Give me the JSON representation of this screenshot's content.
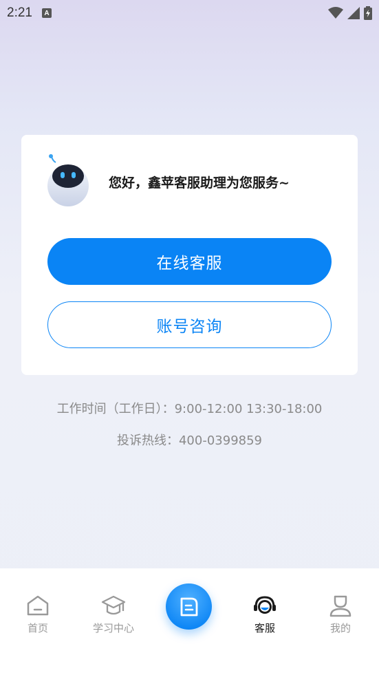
{
  "status_bar": {
    "time": "2:21",
    "a_badge": "A"
  },
  "card": {
    "greeting": "您好，鑫苹客服助理为您服务~",
    "online_service_label": "在线客服",
    "account_consult_label": "账号咨询"
  },
  "info": {
    "hours": "工作时间（工作日）：9:00-12:00   13:30-18:00",
    "hotline": "投诉热线：400-0399859"
  },
  "tabbar": {
    "tabs": [
      {
        "label": "首页",
        "icon": "home-icon"
      },
      {
        "label": "学习中心",
        "icon": "graduation-cap-icon"
      },
      {
        "label": "",
        "icon": "document-icon"
      },
      {
        "label": "客服",
        "icon": "headset-icon"
      },
      {
        "label": "我的",
        "icon": "person-icon"
      }
    ],
    "active": "客服"
  },
  "colors": {
    "accent": "#0a84f5",
    "text_dark": "#1a1a1a",
    "text_muted": "#8a8a8a"
  }
}
